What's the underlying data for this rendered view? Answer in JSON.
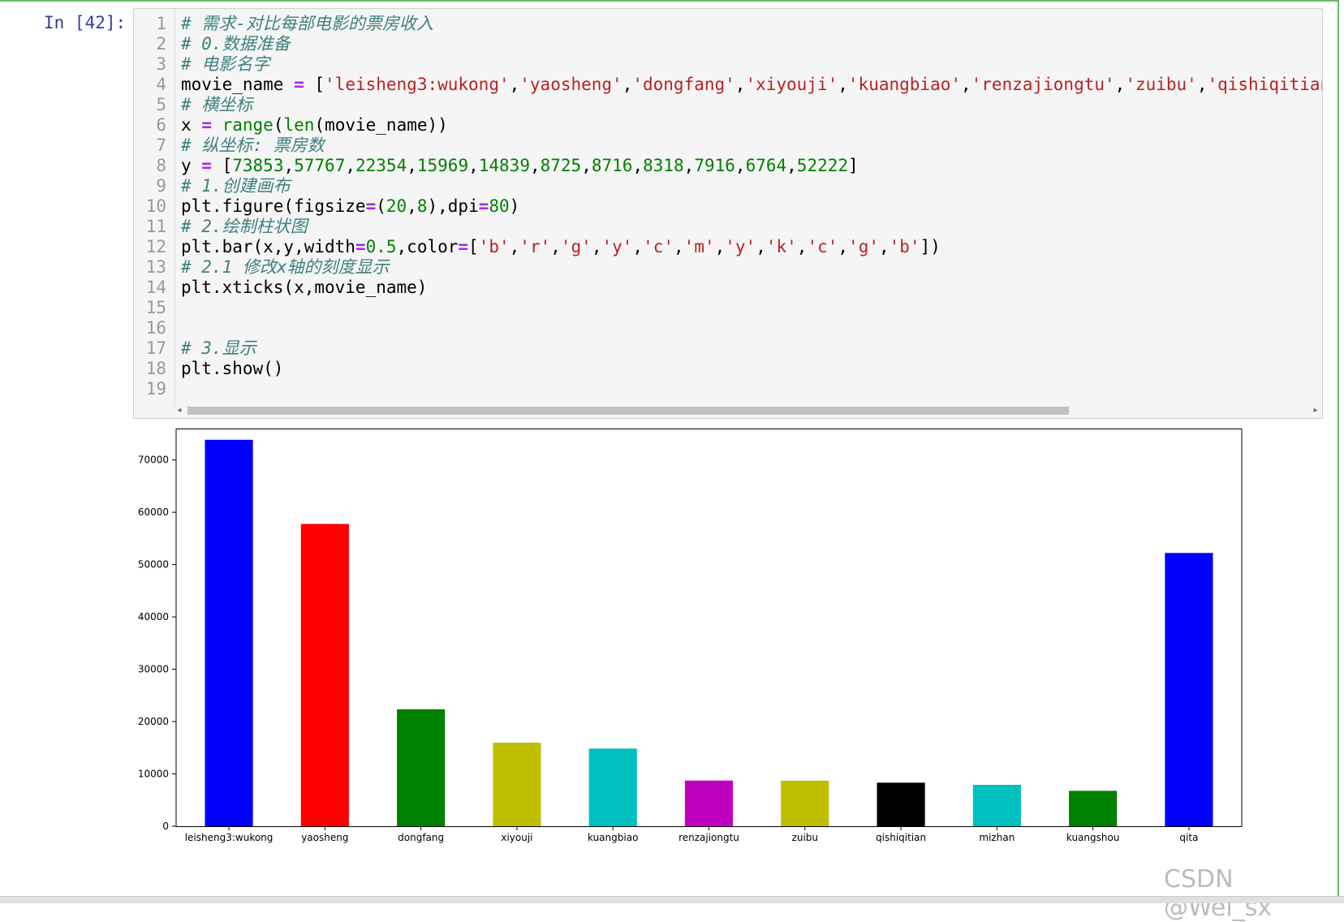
{
  "cell": {
    "prompt": "In [42]:",
    "line_numbers": [
      "1",
      "2",
      "3",
      "4",
      "5",
      "6",
      "7",
      "8",
      "9",
      "10",
      "11",
      "12",
      "13",
      "14",
      "15",
      "16",
      "17",
      "18",
      "19"
    ],
    "code_lines": [
      [
        {
          "t": "# 需求-对比每部电影的票房收入",
          "c": "comment"
        }
      ],
      [
        {
          "t": "# 0.数据准备",
          "c": "comment"
        }
      ],
      [
        {
          "t": "# 电影名字",
          "c": "comment"
        }
      ],
      [
        {
          "t": "movie_name ",
          "c": ""
        },
        {
          "t": "=",
          "c": "op"
        },
        {
          "t": " [",
          "c": ""
        },
        {
          "t": "'leisheng3:wukong'",
          "c": "str"
        },
        {
          "t": ",",
          "c": ""
        },
        {
          "t": "'yaosheng'",
          "c": "str"
        },
        {
          "t": ",",
          "c": ""
        },
        {
          "t": "'dongfang'",
          "c": "str"
        },
        {
          "t": ",",
          "c": ""
        },
        {
          "t": "'xiyouji'",
          "c": "str"
        },
        {
          "t": ",",
          "c": ""
        },
        {
          "t": "'kuangbiao'",
          "c": "str"
        },
        {
          "t": ",",
          "c": ""
        },
        {
          "t": "'renzajiongtu'",
          "c": "str"
        },
        {
          "t": ",",
          "c": ""
        },
        {
          "t": "'zuibu'",
          "c": "str"
        },
        {
          "t": ",",
          "c": ""
        },
        {
          "t": "'qishiqitian",
          "c": "str"
        }
      ],
      [
        {
          "t": "# 横坐标",
          "c": "comment"
        }
      ],
      [
        {
          "t": "x ",
          "c": ""
        },
        {
          "t": "=",
          "c": "op"
        },
        {
          "t": " ",
          "c": ""
        },
        {
          "t": "range",
          "c": "builtin"
        },
        {
          "t": "(",
          "c": ""
        },
        {
          "t": "len",
          "c": "builtin"
        },
        {
          "t": "(movie_name))",
          "c": ""
        }
      ],
      [
        {
          "t": "# 纵坐标: 票房数",
          "c": "comment"
        }
      ],
      [
        {
          "t": "y ",
          "c": ""
        },
        {
          "t": "=",
          "c": "op"
        },
        {
          "t": " [",
          "c": ""
        },
        {
          "t": "73853",
          "c": "num"
        },
        {
          "t": ",",
          "c": ""
        },
        {
          "t": "57767",
          "c": "num"
        },
        {
          "t": ",",
          "c": ""
        },
        {
          "t": "22354",
          "c": "num"
        },
        {
          "t": ",",
          "c": ""
        },
        {
          "t": "15969",
          "c": "num"
        },
        {
          "t": ",",
          "c": ""
        },
        {
          "t": "14839",
          "c": "num"
        },
        {
          "t": ",",
          "c": ""
        },
        {
          "t": "8725",
          "c": "num"
        },
        {
          "t": ",",
          "c": ""
        },
        {
          "t": "8716",
          "c": "num"
        },
        {
          "t": ",",
          "c": ""
        },
        {
          "t": "8318",
          "c": "num"
        },
        {
          "t": ",",
          "c": ""
        },
        {
          "t": "7916",
          "c": "num"
        },
        {
          "t": ",",
          "c": ""
        },
        {
          "t": "6764",
          "c": "num"
        },
        {
          "t": ",",
          "c": ""
        },
        {
          "t": "52222",
          "c": "num"
        },
        {
          "t": "]",
          "c": ""
        }
      ],
      [
        {
          "t": "# 1.创建画布",
          "c": "comment"
        }
      ],
      [
        {
          "t": "plt.figure(figsize",
          "c": ""
        },
        {
          "t": "=",
          "c": "op"
        },
        {
          "t": "(",
          "c": ""
        },
        {
          "t": "20",
          "c": "num"
        },
        {
          "t": ",",
          "c": ""
        },
        {
          "t": "8",
          "c": "num"
        },
        {
          "t": "),dpi",
          "c": ""
        },
        {
          "t": "=",
          "c": "op"
        },
        {
          "t": "80",
          "c": "num"
        },
        {
          "t": ")",
          "c": ""
        }
      ],
      [
        {
          "t": "# 2.绘制柱状图",
          "c": "comment"
        }
      ],
      [
        {
          "t": "plt.bar(x,y,width",
          "c": ""
        },
        {
          "t": "=",
          "c": "op"
        },
        {
          "t": "0.5",
          "c": "num"
        },
        {
          "t": ",color",
          "c": ""
        },
        {
          "t": "=",
          "c": "op"
        },
        {
          "t": "[",
          "c": ""
        },
        {
          "t": "'b'",
          "c": "str"
        },
        {
          "t": ",",
          "c": ""
        },
        {
          "t": "'r'",
          "c": "str"
        },
        {
          "t": ",",
          "c": ""
        },
        {
          "t": "'g'",
          "c": "str"
        },
        {
          "t": ",",
          "c": ""
        },
        {
          "t": "'y'",
          "c": "str"
        },
        {
          "t": ",",
          "c": ""
        },
        {
          "t": "'c'",
          "c": "str"
        },
        {
          "t": ",",
          "c": ""
        },
        {
          "t": "'m'",
          "c": "str"
        },
        {
          "t": ",",
          "c": ""
        },
        {
          "t": "'y'",
          "c": "str"
        },
        {
          "t": ",",
          "c": ""
        },
        {
          "t": "'k'",
          "c": "str"
        },
        {
          "t": ",",
          "c": ""
        },
        {
          "t": "'c'",
          "c": "str"
        },
        {
          "t": ",",
          "c": ""
        },
        {
          "t": "'g'",
          "c": "str"
        },
        {
          "t": ",",
          "c": ""
        },
        {
          "t": "'b'",
          "c": "str"
        },
        {
          "t": "])",
          "c": ""
        }
      ],
      [
        {
          "t": "# 2.1 修改x轴的刻度显示",
          "c": "comment"
        }
      ],
      [
        {
          "t": "plt.xticks(x,movie_name)",
          "c": ""
        }
      ],
      [],
      [],
      [
        {
          "t": "# 3.显示",
          "c": "comment"
        }
      ],
      [
        {
          "t": "plt.show()",
          "c": ""
        }
      ],
      []
    ]
  },
  "chart_data": {
    "type": "bar",
    "categories": [
      "leisheng3:wukong",
      "yaosheng",
      "dongfang",
      "xiyouji",
      "kuangbiao",
      "renzajiongtu",
      "zuibu",
      "qishiqitian",
      "mizhan",
      "kuangshou",
      "qita"
    ],
    "values": [
      73853,
      57767,
      22354,
      15969,
      14839,
      8725,
      8716,
      8318,
      7916,
      6764,
      52222
    ],
    "colors": [
      "#0000ff",
      "#ff0000",
      "#008000",
      "#bfbf00",
      "#00bfbf",
      "#bf00bf",
      "#bfbf00",
      "#000000",
      "#00bfbf",
      "#008000",
      "#0000ff"
    ],
    "yticks": [
      "0",
      "10000",
      "20000",
      "30000",
      "40000",
      "50000",
      "60000",
      "70000"
    ],
    "ylim": [
      0,
      76000
    ],
    "bar_width": 0.5,
    "title": "",
    "xlabel": "",
    "ylabel": ""
  },
  "watermark": "CSDN @Wei_sx"
}
